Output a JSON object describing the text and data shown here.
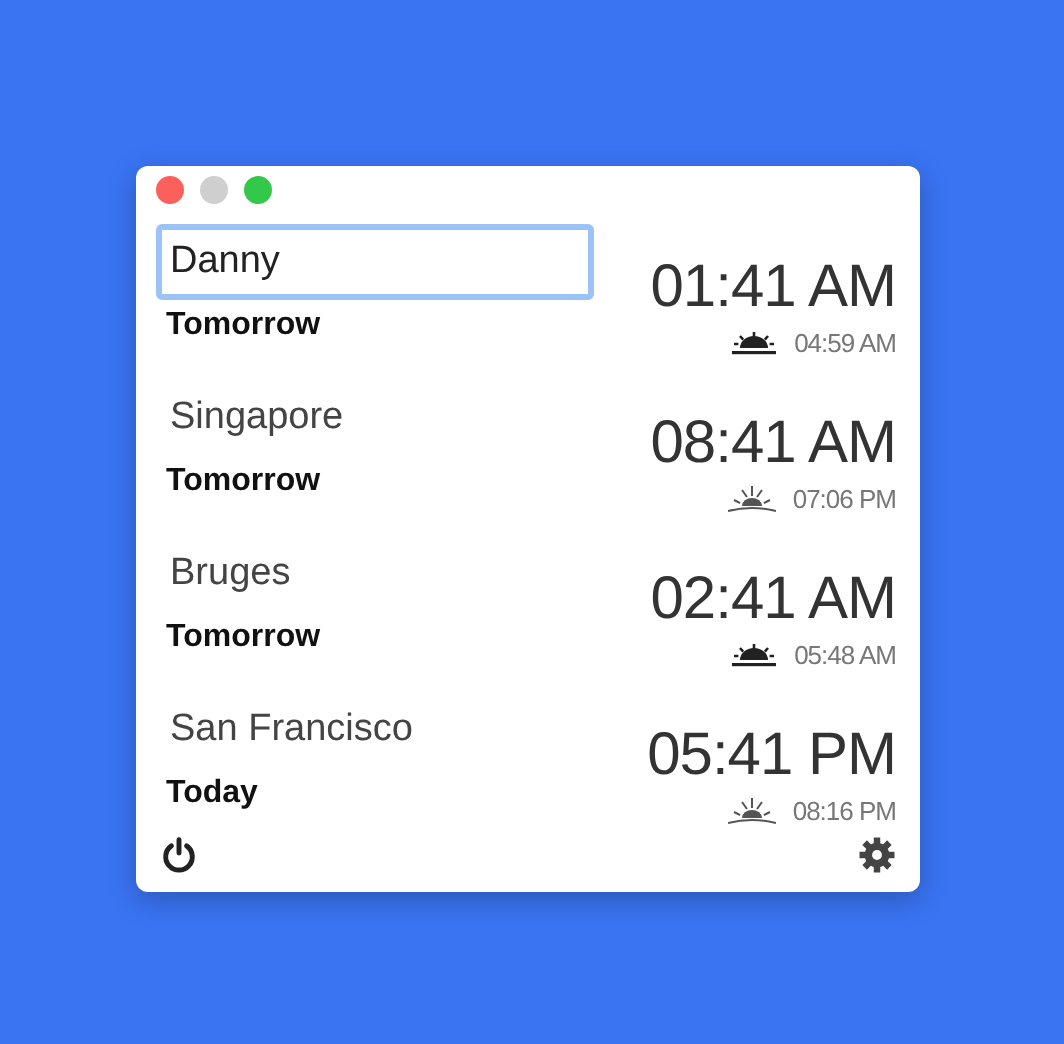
{
  "window": {
    "controls": [
      {
        "kind": "close"
      },
      {
        "kind": "minimize"
      },
      {
        "kind": "zoom"
      }
    ]
  },
  "clocks": [
    {
      "name": "Danny",
      "editing": true,
      "day": "Tomorrow",
      "time": "01:41 AM",
      "sun": {
        "kind": "sunrise",
        "time": "04:59 AM"
      }
    },
    {
      "name": "Singapore",
      "editing": false,
      "day": "Tomorrow",
      "time": "08:41 AM",
      "sun": {
        "kind": "sunset",
        "time": "07:06 PM"
      }
    },
    {
      "name": "Bruges",
      "editing": false,
      "day": "Tomorrow",
      "time": "02:41 AM",
      "sun": {
        "kind": "sunrise",
        "time": "05:48 AM"
      }
    },
    {
      "name": "San Francisco",
      "editing": false,
      "day": "Today",
      "time": "05:41 PM",
      "sun": {
        "kind": "sunset",
        "time": "08:16 PM"
      }
    }
  ]
}
